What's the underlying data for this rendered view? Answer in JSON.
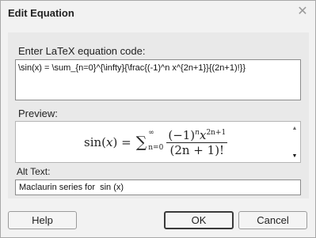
{
  "dialog": {
    "title": "Edit Equation",
    "close_label": "✕"
  },
  "code": {
    "label": "Enter LaTeX equation code:",
    "value": "\\sin(x) = \\sum_{n=0}^{\\infty}{\\frac{(-1)^n x^{2n+1}}{(2n+1)!}}"
  },
  "preview": {
    "label": "Preview:",
    "lhs": "sin(",
    "var": "x",
    "rhs_close": ") =",
    "sum_symbol": "∑",
    "upper": "∞",
    "lower": "n=0",
    "num_base": "(−1)",
    "num_exp_n": "n",
    "num_x": "x",
    "num_exp_2n1": "2n+1",
    "den": "(2n + 1)!",
    "scroll_up": "▲",
    "scroll_down": "▼"
  },
  "alt_text": {
    "label": "Alt Text:",
    "value": "Maclaurin series for  sin (x)"
  },
  "buttons": {
    "help": "Help",
    "ok": "OK",
    "cancel": "Cancel"
  }
}
